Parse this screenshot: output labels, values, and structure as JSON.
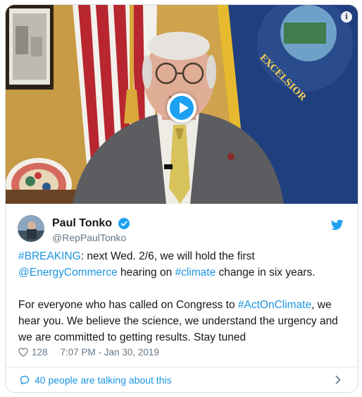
{
  "video": {
    "info_symbol": "i",
    "flag_text": "EXCELSIOR",
    "play_icon": "play-icon"
  },
  "author": {
    "name": "Paul Tonko",
    "handle": "@RepPaulTonko",
    "verified_icon": "verified-badge-icon",
    "platform_icon": "twitter-bird-icon"
  },
  "tweet": {
    "line1": {
      "hashtag": "#BREAKING",
      "text": ": next Wed. 2/6, we will hold the first"
    },
    "line2": {
      "mention": "@EnergyCommerce",
      "text_a": " hearing on ",
      "hashtag": "#climate",
      "text_b": " change in six years."
    },
    "para2": {
      "text_a": "For everyone who has called on Congress to ",
      "hashtag": "#ActOnClimate",
      "text_b": ", we hear you. We believe the science, we understand the urgency and we are committed to getting results. Stay tuned"
    }
  },
  "meta": {
    "likes": "128",
    "timestamp": "7:07 PM - Jan 30, 2019"
  },
  "footer": {
    "talking_label": "40 people are talking about this"
  },
  "colors": {
    "link": "#1b95e0",
    "play_button": "#1da1f2",
    "secondary_text": "#657786",
    "border": "#d9dee2"
  }
}
